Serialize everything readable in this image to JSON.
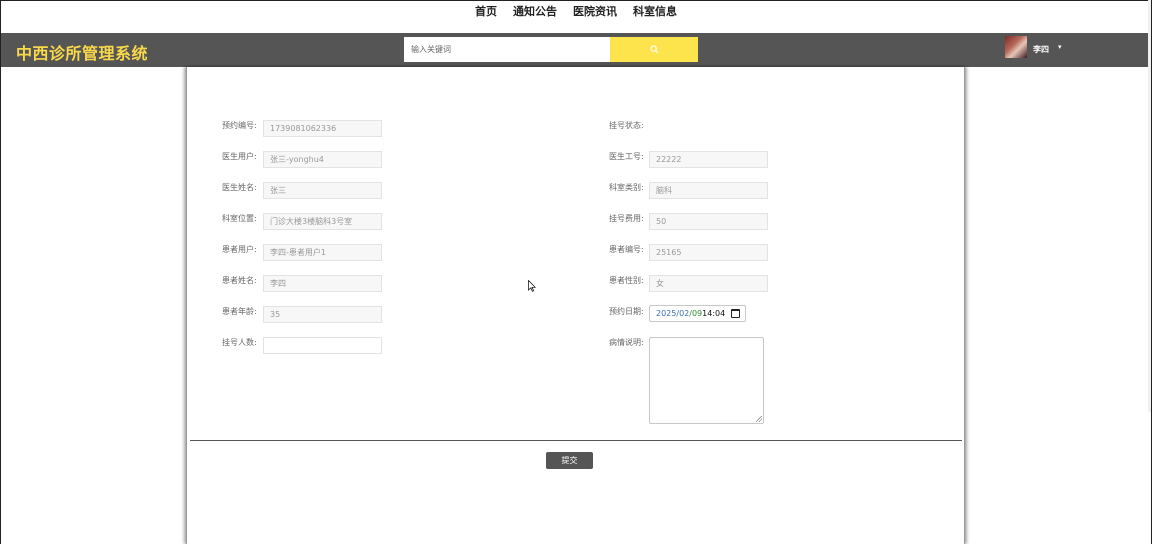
{
  "topnav": {
    "items": [
      "首页",
      "通知公告",
      "医院资讯",
      "科室信息"
    ]
  },
  "header": {
    "brand": "中西诊所管理系统",
    "search_placeholder": "输入关键词",
    "username": "李四",
    "colors": {
      "bar": "#555555",
      "brand": "#f9d949",
      "search_button": "#fde44d"
    }
  },
  "form": {
    "left": [
      {
        "label": "预约编号:",
        "value": "1739081062336"
      },
      {
        "label": "医生用户:",
        "value": "张三-yonghu4"
      },
      {
        "label": "医生姓名:",
        "value": "张三"
      },
      {
        "label": "科室位置:",
        "value": "门诊大楼3楼脑科3号室"
      },
      {
        "label": "患者用户:",
        "value": "李四-患者用户1"
      },
      {
        "label": "患者姓名:",
        "value": "李四"
      },
      {
        "label": "患者年龄:",
        "value": "35"
      },
      {
        "label": "挂号人数:",
        "value": ""
      }
    ],
    "right": [
      {
        "label": "挂号状态:",
        "value": ""
      },
      {
        "label": "医生工号:",
        "value": "22222"
      },
      {
        "label": "科室类别:",
        "value": "脑科"
      },
      {
        "label": "挂号费用:",
        "value": "50"
      },
      {
        "label": "患者编号:",
        "value": "25165"
      },
      {
        "label": "患者性别:",
        "value": "女"
      }
    ],
    "date": {
      "label": "预约日期:",
      "year": "2025",
      "sep1": "/",
      "month": "02",
      "sep2": "/",
      "day": "09",
      "time": " 14:04"
    },
    "notes_label": "病情说明:",
    "submit_label": "提交"
  }
}
